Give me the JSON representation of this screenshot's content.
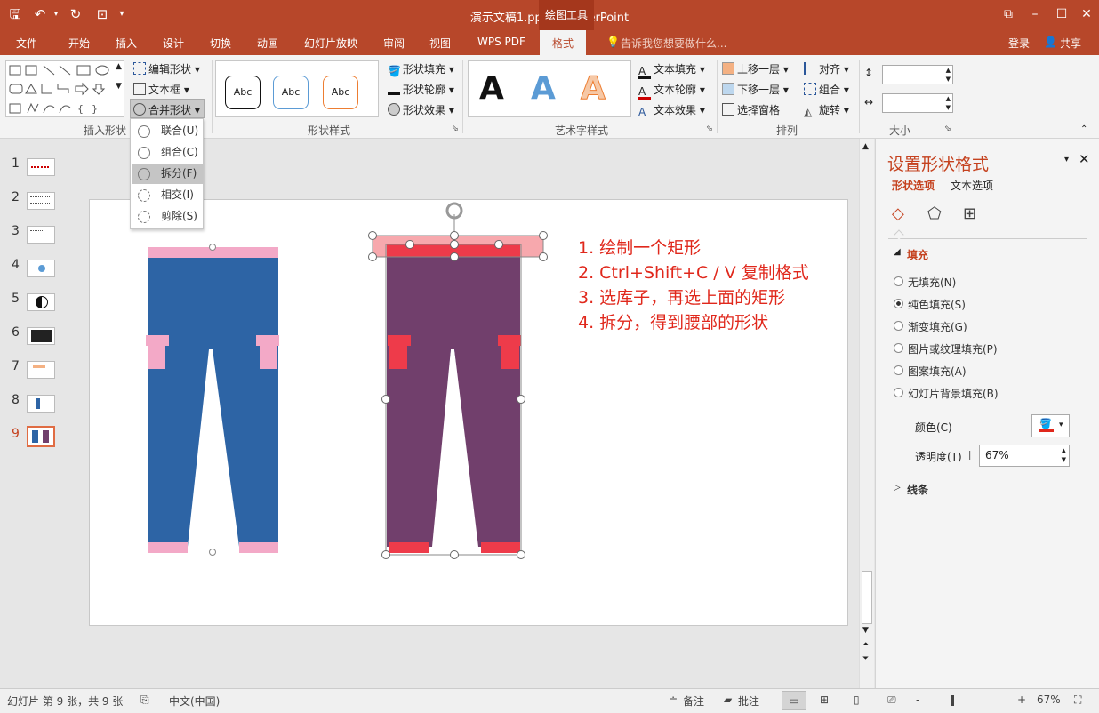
{
  "titlebar": {
    "title": "演示文稿1.pptx - PowerPoint",
    "context_tab": "绘图工具",
    "icons": [
      "save-icon",
      "undo-icon",
      "redo-icon",
      "start-from-beginning-icon",
      "customize-qat-icon"
    ],
    "window_buttons": [
      "restore-ribbon-icon",
      "minimize-icon",
      "maximize-icon",
      "close-icon"
    ]
  },
  "menu": {
    "items": [
      "文件",
      "开始",
      "插入",
      "设计",
      "切换",
      "动画",
      "幻灯片放映",
      "审阅",
      "视图",
      "WPS PDF",
      "格式"
    ],
    "active": "格式",
    "tell_me": "告诉我您想要做什么...",
    "login": "登录",
    "share": "共享"
  },
  "ribbon": {
    "insert_shapes": {
      "label": "插入形状",
      "edit_shape": "编辑形状",
      "text_box": "文本框",
      "merge_shapes": "合并形状"
    },
    "shape_styles": {
      "label": "形状样式",
      "samples": [
        "Abc",
        "Abc",
        "Abc"
      ],
      "fill": "形状填充",
      "outline": "形状轮廓",
      "effects": "形状效果"
    },
    "wordart": {
      "label": "艺术字样式",
      "samples": [
        "A",
        "A",
        "A"
      ],
      "text_fill": "文本填充",
      "text_outline": "文本轮廓",
      "text_effects": "文本效果"
    },
    "arrange": {
      "label": "排列",
      "bring_forward": "上移一层",
      "send_backward": "下移一层",
      "selection_pane": "选择窗格",
      "align": "对齐",
      "group": "组合",
      "rotate": "旋转"
    },
    "size": {
      "label": "大小",
      "height": "",
      "width": ""
    }
  },
  "merge_menu": {
    "items": [
      "联合(U)",
      "组合(C)",
      "拆分(F)",
      "相交(I)",
      "剪除(S)"
    ],
    "highlighted": "拆分(F)"
  },
  "thumbnails": {
    "numbers": [
      "1",
      "2",
      "3",
      "4",
      "5",
      "6",
      "7",
      "8",
      "9"
    ],
    "selected": "9"
  },
  "slide": {
    "instructions": [
      "1. 绘制一个矩形",
      "2. Ctrl+Shift+C / V 复制格式",
      "3. 选库子，再选上面的矩形",
      "4. 拆分，得到腰部的形状"
    ],
    "colors": {
      "pants_blue": "#2d64a5",
      "pants_pink": "#f3a9c7",
      "overlay_purple": "#713f6c",
      "rect_pink": "#f7a8ad",
      "rect_red": "#ee3b4a",
      "instruction_red": "#e0281c"
    }
  },
  "format_pane": {
    "title": "设置形状格式",
    "tabs": [
      "形状选项",
      "文本选项"
    ],
    "active_tab": "形状选项",
    "section_fill": "填充",
    "fill_options": [
      "无填充(N)",
      "纯色填充(S)",
      "渐变填充(G)",
      "图片或纹理填充(P)",
      "图案填充(A)",
      "幻灯片背景填充(B)"
    ],
    "selected_fill": "纯色填充(S)",
    "color_label": "颜色(C)",
    "transparency_label": "透明度(T)",
    "transparency_value": "67%",
    "section_line": "线条"
  },
  "status": {
    "slide_info": "幻灯片 第 9 张，共 9 张",
    "language": "中文(中国)",
    "notes": "备注",
    "comments": "批注",
    "zoom_minus": "-",
    "zoom_plus": "+",
    "zoom": "67%"
  }
}
